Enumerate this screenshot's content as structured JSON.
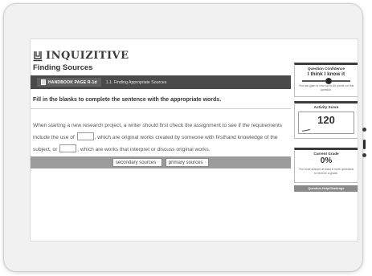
{
  "app": {
    "logo_text": "INQUIZITIVE",
    "page_title": "Finding Sources"
  },
  "handbook": {
    "badge_label": "HANDBOOK PAGE R-1d",
    "link_label": "1.1. Finding Appropriate Sources"
  },
  "question": {
    "instructions": "Fill in the blanks to complete the sentence with the appropriate words.",
    "part1": "When starting a new research project, a writer should first check the assignment to see if the requirements include the use of",
    "part2": ", which are original works created by someone with firsthand knowledge of the subject, or",
    "part3": ", which are works that interpret or discuss original works."
  },
  "answers": [
    {
      "label": "secondary sources",
      "marker": "°"
    },
    {
      "label": "primary sources",
      "marker": "°"
    }
  ],
  "confidence": {
    "title": "Question Confidence",
    "value": "I think I know it",
    "level_percent": 55,
    "note": "You can gain or lose up to 60 points on this question."
  },
  "activity_score": {
    "title": "Activity Score",
    "value": "120"
  },
  "current_grade": {
    "title": "Current Grade",
    "value": "0%",
    "note": "You must answer at least 8 more questions to receive a grade."
  },
  "help_button_label": "Question Help/Challenge"
}
